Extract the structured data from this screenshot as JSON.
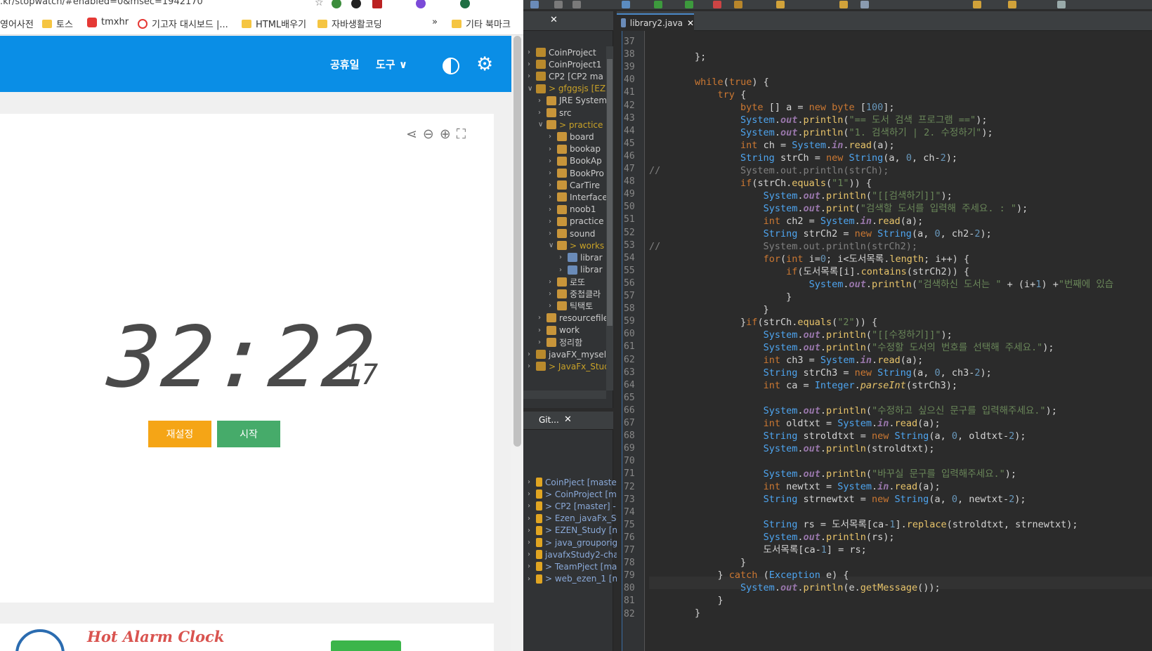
{
  "browser": {
    "url": ".kr/stopwatch/#enabled=0&msec=1942170",
    "bookmarks": [
      "영어사전",
      "토스",
      "tmxhr",
      "기고자 대시보드 |...",
      "HTML배우기",
      "자바생활코딩",
      "기타 북마크"
    ],
    "bookmarks_more": "»",
    "nav": {
      "holidays": "공휴일",
      "tools": "도구 ∨"
    },
    "timer": {
      "main": "32:22",
      "ms": ".17"
    },
    "buttons": {
      "reset": "재설정",
      "start": "시작"
    },
    "ad": {
      "title": "Hot Alarm Clock"
    },
    "colors": {
      "header": "#0a8ee6",
      "reset": "#f5a516",
      "start": "#46ab6a"
    }
  },
  "ide": {
    "editor_tab": "library2.java",
    "package_explorer": [
      {
        "label": "CoinProject",
        "level": 0,
        "chev": "›"
      },
      {
        "label": "CoinProject1",
        "level": 0,
        "chev": "›"
      },
      {
        "label": "CP2 [CP2 ma",
        "level": 0,
        "chev": "›"
      },
      {
        "label": "> gfggsjs [EZE",
        "level": 0,
        "chev": "∨"
      },
      {
        "label": "JRE System",
        "level": 1,
        "chev": "›"
      },
      {
        "label": "src",
        "level": 1,
        "chev": "›"
      },
      {
        "label": "> practice",
        "level": 1,
        "chev": "∨"
      },
      {
        "label": "board",
        "level": 2,
        "chev": "›"
      },
      {
        "label": "bookap",
        "level": 2,
        "chev": "›"
      },
      {
        "label": "BookAp",
        "level": 2,
        "chev": "›"
      },
      {
        "label": "BookPro",
        "level": 2,
        "chev": "›"
      },
      {
        "label": "CarTire",
        "level": 2,
        "chev": "›"
      },
      {
        "label": "Interface",
        "level": 2,
        "chev": "›"
      },
      {
        "label": "noob1",
        "level": 2,
        "chev": "›"
      },
      {
        "label": "practice",
        "level": 2,
        "chev": "›"
      },
      {
        "label": "sound",
        "level": 2,
        "chev": "›"
      },
      {
        "label": "> works",
        "level": 2,
        "chev": "∨"
      },
      {
        "label": "librar",
        "level": 3,
        "chev": "›"
      },
      {
        "label": "librar",
        "level": 3,
        "chev": "›"
      },
      {
        "label": "로또",
        "level": 2,
        "chev": "›"
      },
      {
        "label": "중첩클라",
        "level": 2,
        "chev": "›"
      },
      {
        "label": "틱택토",
        "level": 2,
        "chev": "›"
      },
      {
        "label": "resourcefile",
        "level": 1,
        "chev": "›"
      },
      {
        "label": "work",
        "level": 1,
        "chev": "›"
      },
      {
        "label": "정리함",
        "level": 1,
        "chev": "›"
      },
      {
        "label": "javaFX_myself",
        "level": 0,
        "chev": "›"
      },
      {
        "label": "> JavaFx_Stud",
        "level": 0,
        "chev": "›"
      }
    ],
    "git_tab": "Git...",
    "git_repos": [
      "CoinPject [maste",
      "> CoinProject [m",
      "> CP2 [master] -",
      "> Ezen_javaFx_St",
      "> EZEN_Study [n",
      "> java_grouporig",
      "javafxStudy2-cha",
      "> TeamPject [ma",
      "> web_ezen_1 [n"
    ],
    "line_numbers": [
      "37",
      "38",
      "39",
      "40",
      "41",
      "42",
      "43",
      "44",
      "45",
      "46",
      "47",
      "48",
      "49",
      "50",
      "51",
      "52",
      "53",
      "54",
      "55",
      "56",
      "57",
      "58",
      "59",
      "60",
      "61",
      "62",
      "63",
      "64",
      "65",
      "66",
      "67",
      "68",
      "69",
      "70",
      "71",
      "72",
      "73",
      "74",
      "75",
      "76",
      "77",
      "78",
      "79",
      "80",
      "81",
      "82"
    ]
  }
}
